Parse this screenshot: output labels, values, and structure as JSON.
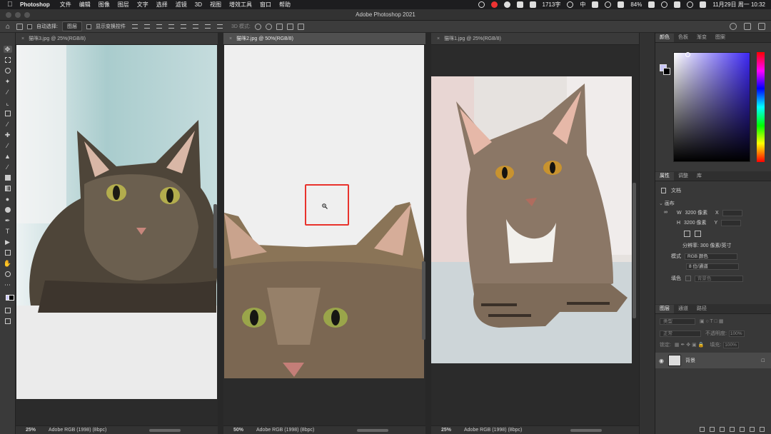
{
  "menubar": {
    "app_name": "Photoshop",
    "items": [
      "文件",
      "编辑",
      "图像",
      "图层",
      "文字",
      "选择",
      "滤镜",
      "3D",
      "视图",
      "增效工具",
      "窗口",
      "帮助"
    ],
    "word_count": "1713字",
    "input_method": "中",
    "battery": "84%",
    "datetime": "11月29日 周一 10:32"
  },
  "window": {
    "title": "Adobe Photoshop 2021"
  },
  "options_bar": {
    "auto_select_label": "自动选择:",
    "auto_select_value": "图层",
    "show_transform_label": "显示变换控件",
    "mode_3d_label": "3D 模式:"
  },
  "documents": [
    {
      "tab_title": "猫咪3.jpg @ 25%(RGB/8)",
      "zoom": "25%",
      "profile": "Adobe RGB (1998) (8bpc)",
      "active": false
    },
    {
      "tab_title": "猫咪2.jpg @ 50%(RGB/8)",
      "zoom": "50%",
      "profile": "Adobe RGB (1998) (8bpc)",
      "active": true
    },
    {
      "tab_title": "猫咪1.jpg @ 25%(RGB/8)",
      "zoom": "25%",
      "profile": "Adobe RGB (1998) (8bpc)",
      "active": false
    }
  ],
  "color_panel": {
    "tabs": [
      "颜色",
      "色板",
      "渐变",
      "图案"
    ],
    "foreground": "#c8c6f6",
    "background": "#000000"
  },
  "properties_panel": {
    "tabs": [
      "属性",
      "调整",
      "库"
    ],
    "doc_label": "文档",
    "canvas_label": "画布",
    "width_label": "W",
    "width_value": "3200 像素",
    "x_label": "X",
    "height_label": "H",
    "height_value": "3200 像素",
    "y_label": "Y",
    "resolution": "分辨率: 300 像素/英寸",
    "mode_label": "模式",
    "mode_value": "RGB 颜色",
    "depth_value": "8 位/通道",
    "fill_label": "填色",
    "fill_value": "背景色"
  },
  "layers_panel": {
    "tabs": [
      "图层",
      "通道",
      "路径"
    ],
    "kind_placeholder": "类型",
    "blend_mode": "正常",
    "opacity_label": "不透明度:",
    "opacity_value": "100%",
    "lock_label": "锁定:",
    "fill_label": "填充:",
    "fill_value": "100%",
    "layers": [
      {
        "name": "背景",
        "visible": true,
        "locked": true
      }
    ]
  },
  "icons": {
    "zoom_cursor": "magnifier-icon",
    "eye": "eye-icon",
    "lock": "lock-icon"
  },
  "highlight_color": "#e8322c"
}
